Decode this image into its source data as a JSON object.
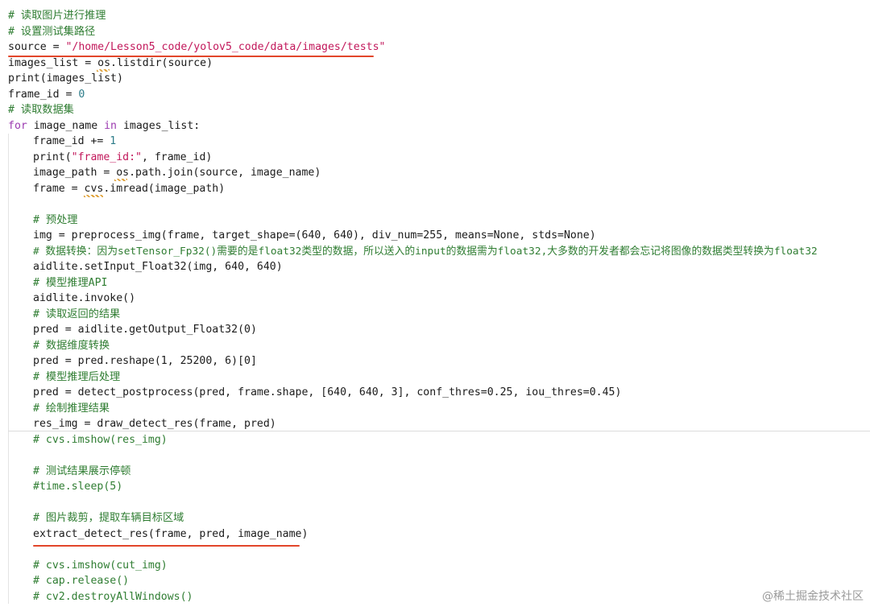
{
  "lines": {
    "l1": "# 读取图片进行推理",
    "l2": "# 设置测试集路径",
    "l3_var": "source",
    "l3_eq": " = ",
    "l3_str": "\"/home/Lesson5_code/yolov5_code/data/images/tests\"",
    "l4": "images_list = os.listdir(source)",
    "l5": "print(images_list)",
    "l6_a": "frame_id = ",
    "l6_n": "0",
    "l7": "# 读取数据集",
    "l8_for": "for",
    "l8_mid": " image_name ",
    "l8_in": "in",
    "l8_end": " images_list:",
    "l9_a": "frame_id += ",
    "l9_n": "1",
    "l10_a": "print(",
    "l10_s": "\"frame_id:\"",
    "l10_b": ", frame_id)",
    "l11": "image_path = os.path.join(source, image_name)",
    "l12": "frame = cvs.imread(image_path)",
    "l13": "# 预处理",
    "l14": "img = preprocess_img(frame, target_shape=(640, 640), div_num=255, means=None, stds=None)",
    "l15": "# 数据转换：因为setTensor_Fp32()需要的是float32类型的数据，所以送入的input的数据需为float32,大多数的开发者都会忘记将图像的数据类型转换为float32",
    "l16": "aidlite.setInput_Float32(img, 640, 640)",
    "l17": "# 模型推理API",
    "l18": "aidlite.invoke()",
    "l19": "# 读取返回的结果",
    "l20": "pred = aidlite.getOutput_Float32(0)",
    "l21": "# 数据维度转换",
    "l22": "pred = pred.reshape(1, 25200, 6)[0]",
    "l23": "# 模型推理后处理",
    "l24": "pred = detect_postprocess(pred, frame.shape, [640, 640, 3], conf_thres=0.25, iou_thres=0.45)",
    "l25": "# 绘制推理结果",
    "l26": "res_img = draw_detect_res(frame, pred)",
    "l27": "# cvs.imshow(res_img)",
    "l28": "# 测试结果展示停顿",
    "l29": "#time.sleep(5)",
    "l30": "# 图片裁剪，提取车辆目标区域",
    "l31": "extract_detect_res(frame, pred, image_name)",
    "l32": "# cvs.imshow(cut_img)",
    "l33": "# cap.release()",
    "l34": "# cv2.destroyAllWindows()"
  },
  "watermark": "@稀土掘金技术社区",
  "colors": {
    "comment": "#2f7d32",
    "keyword": "#9c3bb0",
    "string": "#c2185b",
    "number": "#2e7d8a",
    "highlight_underline": "#e2462a"
  }
}
